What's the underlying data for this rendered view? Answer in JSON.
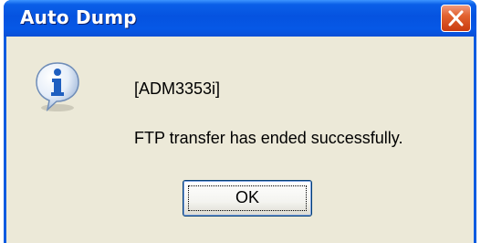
{
  "window": {
    "title": "Auto Dump"
  },
  "message": {
    "code": "[ADM3353i]",
    "text": "FTP transfer has ended successfully."
  },
  "buttons": {
    "ok_label": "OK"
  },
  "icons": {
    "message_icon": "info-icon",
    "close_icon": "close-icon"
  },
  "colors": {
    "titlebar": "#0553e0",
    "client_background": "#ece9d8",
    "close_button": "#e2622f",
    "info_icon_blue": "#1f5fc0"
  }
}
